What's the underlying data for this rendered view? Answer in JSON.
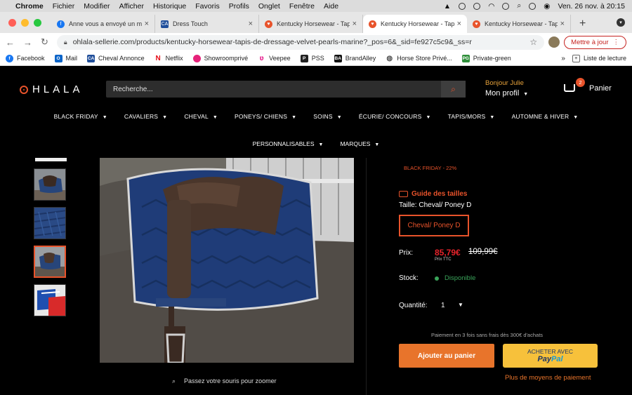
{
  "menubar": {
    "app": "Chrome",
    "items": [
      "Fichier",
      "Modifier",
      "Afficher",
      "Historique",
      "Favoris",
      "Profils",
      "Onglet",
      "Fenêtre",
      "Aide"
    ],
    "clock": "Ven. 26 nov. à  20:15"
  },
  "tabs": [
    {
      "title": "Anne vous a envoyé un m",
      "favicon": "facebook-icon",
      "color": "#1877f2"
    },
    {
      "title": "Dress Touch",
      "favicon": "ca-icon",
      "color": "#1f4e9a"
    },
    {
      "title": "Kentucky Horsewear - Tap",
      "favicon": "ohlala-icon",
      "color": "#e8532b"
    },
    {
      "title": "Kentucky Horsewear - Tap",
      "favicon": "ohlala-icon",
      "color": "#e8532b"
    },
    {
      "title": "Kentucky Horsewear - Tap",
      "favicon": "ohlala-icon",
      "color": "#e8532b"
    }
  ],
  "toolbar": {
    "url": "ohlala-sellerie.com/products/kentucky-horsewear-tapis-de-dressage-velvet-pearls-marine?_pos=6&_sid=fe927c5c9&_ss=r",
    "update_label": "Mettre à jour"
  },
  "bookmarks": [
    {
      "label": "Facebook",
      "icon": "facebook-icon",
      "color": "#1877f2",
      "glyph": "f"
    },
    {
      "label": "Mail",
      "icon": "outlook-icon",
      "color": "#0a64c8",
      "glyph": "O"
    },
    {
      "label": "Cheval Annonce",
      "icon": "ca-icon",
      "color": "#1f4e9a",
      "glyph": "CA"
    },
    {
      "label": "Netflix",
      "icon": "netflix-icon",
      "color": "#e50914",
      "glyph": "N"
    },
    {
      "label": "Showroomprivé",
      "icon": "showroom-icon",
      "color": "#e6227a",
      "glyph": "●"
    },
    {
      "label": "Veepee",
      "icon": "veepee-icon",
      "color": "#e3007e",
      "glyph": "v"
    },
    {
      "label": "PSS",
      "icon": "pss-icon",
      "color": "#222222",
      "glyph": "P"
    },
    {
      "label": "BrandAlley",
      "icon": "brandalley-icon",
      "color": "#111111",
      "glyph": "BA"
    },
    {
      "label": "Horse Store Privé...",
      "icon": "globe-icon",
      "color": "#555555",
      "glyph": "◍"
    },
    {
      "label": "Private-green",
      "icon": "pg-icon",
      "color": "#2f8f3a",
      "glyph": "PG"
    }
  ],
  "reading_list": "Liste de lecture",
  "header": {
    "logo": "HLALA",
    "search_placeholder": "Recherche...",
    "greeting": "Bonjour Julie",
    "profile": "Mon profil",
    "cart_count": "2",
    "cart_label": "Panier"
  },
  "nav": [
    "BLACK FRIDAY",
    "CAVALIERS",
    "CHEVAL",
    "PONEYS/ CHIENS",
    "SOINS",
    "ÉCURIE/ CONCOURS",
    "TAPIS/MORS",
    "AUTOMNE & HIVER"
  ],
  "nav2": [
    "PERSONNALISABLES",
    "MARQUES"
  ],
  "gallery": {
    "zoom_hint": "Passez votre souris pour zoomer",
    "selected_thumb": 2
  },
  "product": {
    "promo": "BLACK FRIDAY - 22%",
    "size_guide": "Guide des tailles",
    "size_label": "Taille:",
    "size_value": "Cheval/ Poney D",
    "size_option": "Cheval/ Poney D",
    "price_label": "Prix:",
    "price_new": "85,79€",
    "price_old": "109,99€",
    "price_note": "Prix TTC",
    "stock_label": "Stock:",
    "stock_value": "Disponible",
    "qty_label": "Quantité:",
    "qty_value": "1",
    "installments": "Paiement en 3 fois sans frais dès 300€ d'achats",
    "add_to_cart": "Ajouter au panier",
    "paypal_top": "ACHETER AVEC",
    "paypal_pay": "Pay",
    "paypal_pal": "Pal",
    "more_payment": "Plus de moyens de paiement"
  }
}
